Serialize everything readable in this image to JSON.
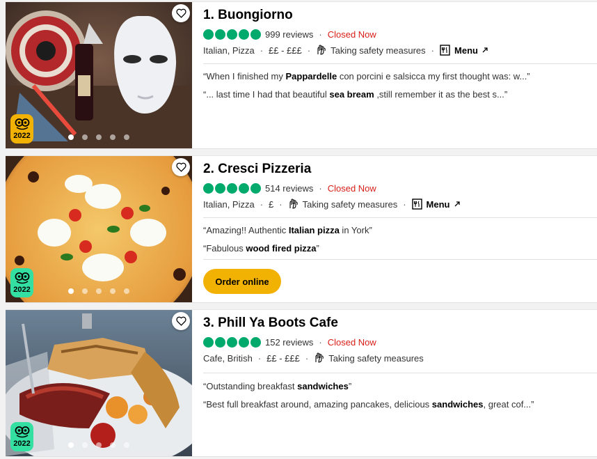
{
  "restaurants": [
    {
      "title": "1. Buongiorno",
      "reviews": "999 reviews",
      "status": "Closed Now",
      "cuisine": "Italian, Pizza",
      "price": "££ - £££",
      "safety": "Taking safety measures",
      "menu": "Menu",
      "award_year": "2022",
      "rating": 5,
      "quotes": [
        {
          "pre": "“When I finished my ",
          "bold": "Pappardelle",
          "post": " con porcini e salsicca my first thought was: w...”"
        },
        {
          "pre": "“... last time I had that beautiful ",
          "bold": "sea bream",
          "post": " ,still remember it as the best s...”"
        }
      ],
      "badge_color": "#f2b203"
    },
    {
      "title": "2. Cresci Pizzeria",
      "reviews": "514 reviews",
      "status": "Closed Now",
      "cuisine": "Italian, Pizza",
      "price": "£",
      "safety": "Taking safety measures",
      "menu": "Menu",
      "award_year": "2022",
      "rating": 5,
      "quotes": [
        {
          "pre": "“Amazing!! Authentic ",
          "bold": "Italian pizza",
          "post": " in York”"
        },
        {
          "pre": "“Fabulous ",
          "bold": "wood fired pizza",
          "post": "”"
        }
      ],
      "order_label": "Order online",
      "badge_color": "#34e0a1"
    },
    {
      "title": "3. Phill Ya Boots Cafe",
      "reviews": "152 reviews",
      "status": "Closed Now",
      "cuisine": "Cafe, British",
      "price": "££ - £££",
      "safety": "Taking safety measures",
      "award_year": "2022",
      "rating": 5,
      "quotes": [
        {
          "pre": "“Outstanding breakfast ",
          "bold": "sandwiches",
          "post": "”"
        },
        {
          "pre": "“Best full breakfast around, amazing pancakes, delicious ",
          "bold": "sandwiches",
          "post": ", great cof...”"
        }
      ],
      "badge_color": "#34e0a1"
    }
  ],
  "colors": {
    "rating_green": "#00aa6c",
    "closed_red": "#d91e18",
    "order_yellow": "#f2b203"
  },
  "icons": [
    "heart-icon",
    "tripadvisor-owl-icon",
    "hands-wash-icon",
    "menu-book-icon",
    "external-arrow-icon"
  ]
}
